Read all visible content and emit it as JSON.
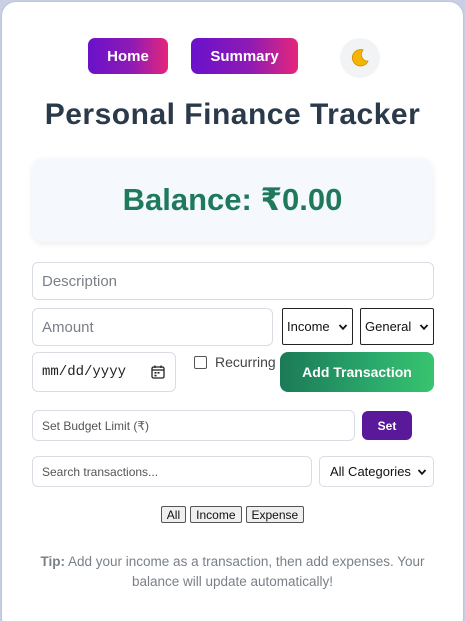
{
  "nav": {
    "home_label": "Home",
    "summary_label": "Summary",
    "theme_icon": "moon-icon"
  },
  "header": {
    "title": "Personal Finance Tracker"
  },
  "balance": {
    "text": "Balance: ₹0.00"
  },
  "form": {
    "description_placeholder": "Description",
    "amount_placeholder": "Amount",
    "type_selected": "Income",
    "category_selected": "General",
    "date_placeholder": "mm/dd/yyyy",
    "recurring_label": "Recurring",
    "add_button_label": "Add Transaction"
  },
  "budget": {
    "placeholder": "Set Budget Limit (₹)",
    "set_label": "Set"
  },
  "search": {
    "placeholder": "Search transactions...",
    "category_selected": "All Categories"
  },
  "filters": {
    "all": "All",
    "income": "Income",
    "expense": "Expense"
  },
  "tip": {
    "label": "Tip:",
    "text": " Add your income as a transaction, then add expenses. Your balance will update automatically!"
  },
  "colors": {
    "nav_gradient_start": "#6a11cb",
    "nav_gradient_end": "#e5267b",
    "balance_green": "#1e7a5b",
    "add_button_green": "#2aa86b",
    "set_button_purple": "#5a189a",
    "title": "#2b3a4a"
  }
}
